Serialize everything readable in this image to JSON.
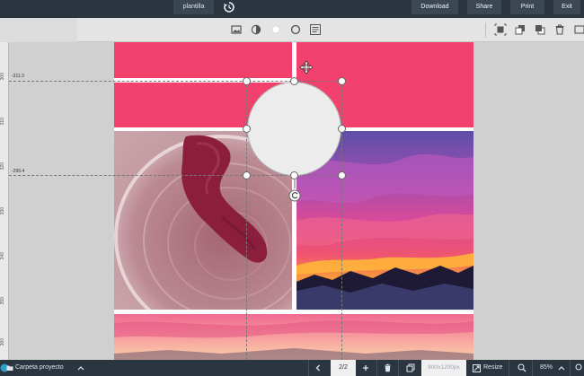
{
  "header": {
    "document_name": "plantilla",
    "buttons": {
      "download": "Download",
      "share": "Share",
      "print": "Print",
      "exit": "Exit"
    }
  },
  "ruler": {
    "labels": [
      "300",
      "310",
      "320",
      "330",
      "340",
      "350",
      "360"
    ]
  },
  "guides": {
    "h1_label": "-311.3",
    "h2_label": "-299.4"
  },
  "footer": {
    "project_label": "Carpeta proyecto",
    "page_indicator": "2/2",
    "size_label": "800x1200px",
    "resize_label": "Resize",
    "zoom_label": "85%"
  },
  "colors": {
    "brand_pink": "#f2416d",
    "toolbar_bg": "#e4e4e4",
    "topbar_bg": "#2b3540",
    "circle_fill": "#ececec"
  },
  "icons": {
    "history": "history-icon",
    "image": "image-icon",
    "contrast": "contrast-icon",
    "color": "color-dot-icon",
    "circle": "circle-icon",
    "align": "align-lines-icon",
    "select": "select-frame-icon",
    "layer_back": "send-back-icon",
    "layer_front": "bring-front-icon",
    "delete": "trash-icon",
    "more": "more-icon"
  }
}
